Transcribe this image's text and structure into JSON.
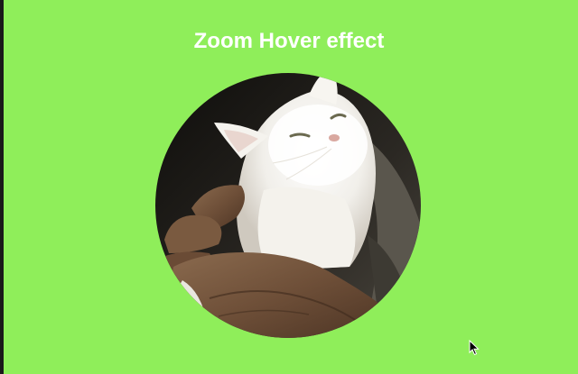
{
  "page": {
    "title": "Zoom Hover effect",
    "background_color": "#8fee5a",
    "title_color": "#ffffff"
  },
  "image": {
    "shape": "circle",
    "subject": "white-kitten-in-hands-photo"
  },
  "cursor": {
    "icon": "mouse-pointer-icon"
  }
}
